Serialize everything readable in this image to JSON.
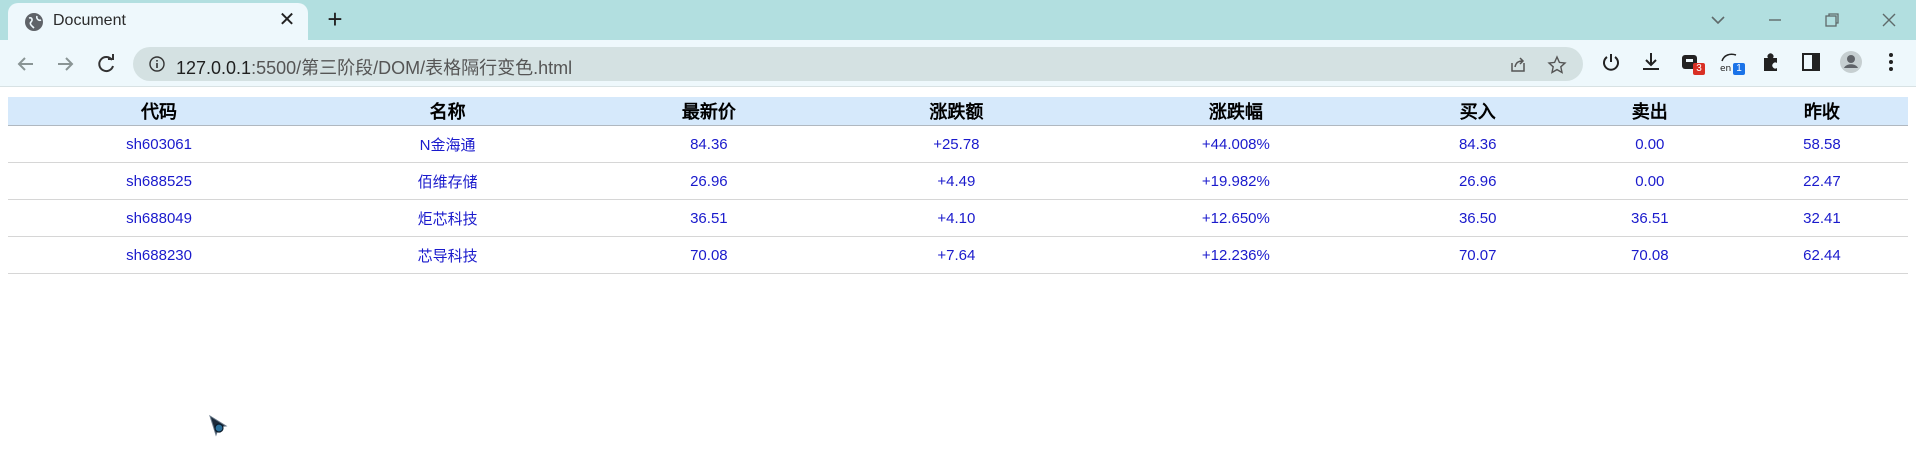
{
  "browser": {
    "tab_title": "Document",
    "new_tab_label": "+",
    "url_host": "127.0.0.1",
    "url_path": ":5500/第三阶段/DOM/表格隔行变色.html",
    "extensions": [
      {
        "name": "puzzle-extension",
        "badge": "3"
      },
      {
        "name": "translate-extension",
        "badge": "1"
      }
    ],
    "badge_colors": {
      "red": "#d93025",
      "blue": "#1a73e8"
    }
  },
  "table": {
    "headers": [
      "代码",
      "名称",
      "最新价",
      "涨跌额",
      "涨跌幅",
      "买入",
      "卖出",
      "昨收"
    ],
    "rows": [
      [
        "sh603061",
        "N金海通",
        "84.36",
        "+25.78",
        "+44.008%",
        "84.36",
        "0.00",
        "58.58"
      ],
      [
        "sh688525",
        "佰维存储",
        "26.96",
        "+4.49",
        "+19.982%",
        "26.96",
        "0.00",
        "22.47"
      ],
      [
        "sh688049",
        "炬芯科技",
        "36.51",
        "+4.10",
        "+12.650%",
        "36.50",
        "36.51",
        "32.41"
      ],
      [
        "sh688230",
        "芯导科技",
        "70.08",
        "+7.64",
        "+12.236%",
        "70.07",
        "70.08",
        "62.44"
      ]
    ],
    "colors": {
      "header_bg": "#d6e9fb",
      "cell_text": "#1a1acc"
    }
  }
}
